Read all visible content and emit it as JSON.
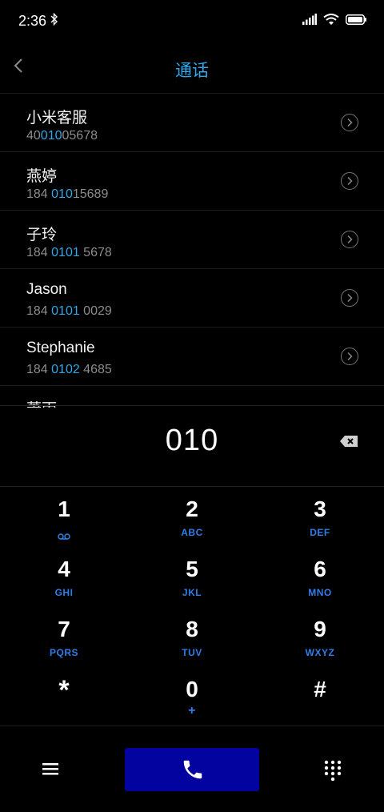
{
  "status": {
    "time": "2:36"
  },
  "header": {
    "title": "通话"
  },
  "contacts": [
    {
      "name": "小米客服",
      "num_pre": "40",
      "num_hl": "010",
      "num_post": "05678"
    },
    {
      "name": "燕婷",
      "num_pre": "184 ",
      "num_hl": "010",
      "num_post": "15689"
    },
    {
      "name": "子玲",
      "num_pre": "184 ",
      "num_hl": "0101",
      "num_post": " 5678"
    },
    {
      "name": "Jason",
      "num_pre": "184 ",
      "num_hl": "0101",
      "num_post": " 0029"
    },
    {
      "name": "Stephanie",
      "num_pre": "184 ",
      "num_hl": "0102",
      "num_post": " 4685"
    },
    {
      "name": "萧雨",
      "num_pre": "",
      "num_hl": "",
      "num_post": ""
    }
  ],
  "dialer": {
    "input": "010"
  },
  "keypad": [
    {
      "digit": "1",
      "sub": ""
    },
    {
      "digit": "2",
      "sub": "ABC"
    },
    {
      "digit": "3",
      "sub": "DEF"
    },
    {
      "digit": "4",
      "sub": "GHI"
    },
    {
      "digit": "5",
      "sub": "JKL"
    },
    {
      "digit": "6",
      "sub": "MNO"
    },
    {
      "digit": "7",
      "sub": "PQRS"
    },
    {
      "digit": "8",
      "sub": "TUV"
    },
    {
      "digit": "9",
      "sub": "WXYZ"
    },
    {
      "digit": "*",
      "sub": ""
    },
    {
      "digit": "0",
      "sub": "+"
    },
    {
      "digit": "#",
      "sub": ""
    }
  ],
  "icons": {
    "bluetooth": "bluetooth-icon",
    "signal": "signal-icon",
    "wifi": "wifi-icon",
    "battery": "battery-icon",
    "back": "back-arrow-icon",
    "detail": "chevron-right-circle-icon",
    "backspace": "backspace-icon",
    "voicemail": "voicemail-icon",
    "menu": "menu-icon",
    "phone": "phone-icon",
    "keypad": "dialpad-icon"
  },
  "colors": {
    "accent": "#2fa7e8",
    "key_sub": "#2f7de8",
    "call": "#0303a0"
  }
}
